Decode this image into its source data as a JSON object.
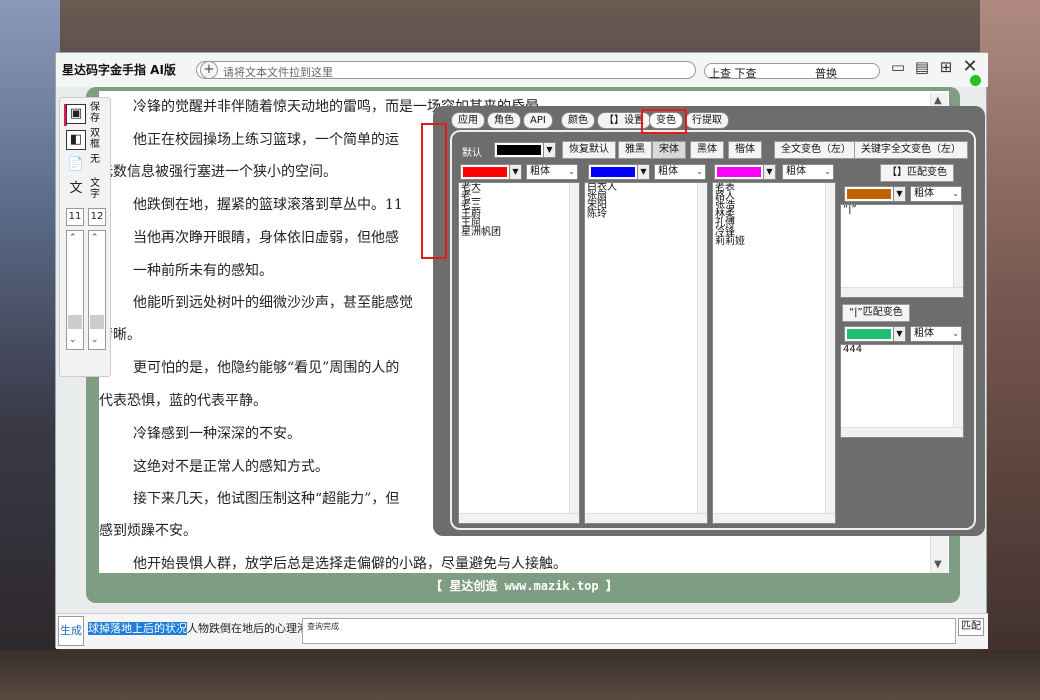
{
  "app": {
    "title": "星达码字金手指 AI版",
    "drop_plus": "+",
    "drop_placeholder": "请将文本文件拉到这里",
    "search_left": "上查 下查",
    "search_right": "普换",
    "footer": "【 星达创造 www.mazik.top 】"
  },
  "left_tools": {
    "save": "保存",
    "dual": "双框",
    "none": "无",
    "text": "文字",
    "text_icon": "文",
    "num_a": "11",
    "num_b": "12"
  },
  "reader": {
    "lines": [
      "冷锋的觉醒并非伴随着惊天动地的雷鸣，而是一场突如其来的昏晕。",
      "他正在校园操场上练习篮球，一个简单的运",
      "无数信息被强行塞进一个狭小的空间。",
      "他跌倒在地，握紧的篮球滚落到草丛中。11",
      "当他再次睁开眼睛，身体依旧虚弱，但他感",
      "一种前所未有的感知。",
      "他能听到远处树叶的细微沙沙声，甚至能感觉",
      "清晰。",
      "更可怕的是，他隐约能够“看见”周围的人的",
      "代表恐惧，蓝的代表平静。",
      "冷锋感到一种深深的不安。",
      "这绝对不是正常人的感知方式。",
      "接下来几天，他试图压制这种“超能力”，但",
      "感到烦躁不安。",
      "他开始畏惧人群，放学后总是选择走偏僻的小路，尽量避免与人接触。"
    ]
  },
  "bottom": {
    "gen": "生成",
    "ticker_hl": "球掉落地上后的状况",
    "ticker_rest": "人物跌倒在地后的心理港",
    "log": "查询完成",
    "match": "匹配"
  },
  "panel": {
    "tabs": [
      "应用",
      "角色",
      "API",
      "颜色",
      "【】设置",
      "变色",
      "行提取"
    ],
    "default_label": "默认",
    "buttons": {
      "restore": "恢复默认",
      "yahei": "雅黑",
      "songti": "宋体",
      "heiti": "黑体",
      "kaiti": "楷体",
      "full_left": "全文变色（左）",
      "kw_full_left": "关键字全文变色（左）",
      "bracket_match": "【】匹配变色",
      "quote_match": "“|”匹配变色"
    },
    "font_bold": "粗体",
    "lists": {
      "red": [
        "老大",
        "老二",
        "老三",
        "王蔚",
        "王屈",
        "星洲帆团"
      ],
      "blue": [
        "白衣人",
        "张扇",
        "宋阳",
        "陈玲"
      ],
      "magenta": [
        "老表",
        "路人",
        "张浩",
        "林柔",
        "孔傅",
        "冷锋",
        "莉莉娅"
      ],
      "brown": [
        "“|”"
      ],
      "green": [
        "444"
      ]
    },
    "colors": {
      "default": "#000000",
      "red": "#ff0000",
      "blue": "#0000ff",
      "magenta": "#ff00ff",
      "brown": "#c46200",
      "green": "#20c070"
    }
  },
  "colors": {
    "frame": "#7e9d82",
    "panel_bg": "#6d6d6d",
    "highlight": "#e21b1b",
    "status": "#22c322"
  }
}
